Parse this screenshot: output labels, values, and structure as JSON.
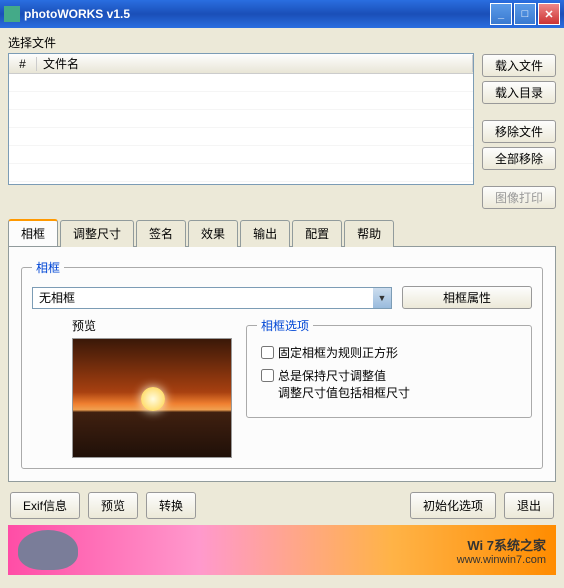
{
  "titlebar": {
    "title": "photoWORKS v1.5"
  },
  "file_section": {
    "label": "选择文件",
    "col_num": "#",
    "col_name": "文件名"
  },
  "side_buttons": {
    "load_file": "载入文件",
    "load_dir": "载入目录",
    "remove_file": "移除文件",
    "remove_all": "全部移除",
    "print": "图像打印"
  },
  "tabs": [
    "相框",
    "调整尺寸",
    "签名",
    "效果",
    "输出",
    "配置",
    "帮助"
  ],
  "frame_panel": {
    "legend": "相框",
    "dropdown_value": "无相框",
    "properties_btn": "相框属性",
    "preview_label": "预览",
    "options_legend": "相框选项",
    "opt1": "固定相框为规则正方形",
    "opt2a": "总是保持尺寸调整值",
    "opt2b": "调整尺寸值包括相框尺寸"
  },
  "bottom": {
    "exif": "Exif信息",
    "preview": "预览",
    "convert": "转换",
    "init": "初始化选项",
    "exit": "退出"
  },
  "banner": {
    "brand": "Wi  7系统之家",
    "url": "www.winwin7.com"
  }
}
